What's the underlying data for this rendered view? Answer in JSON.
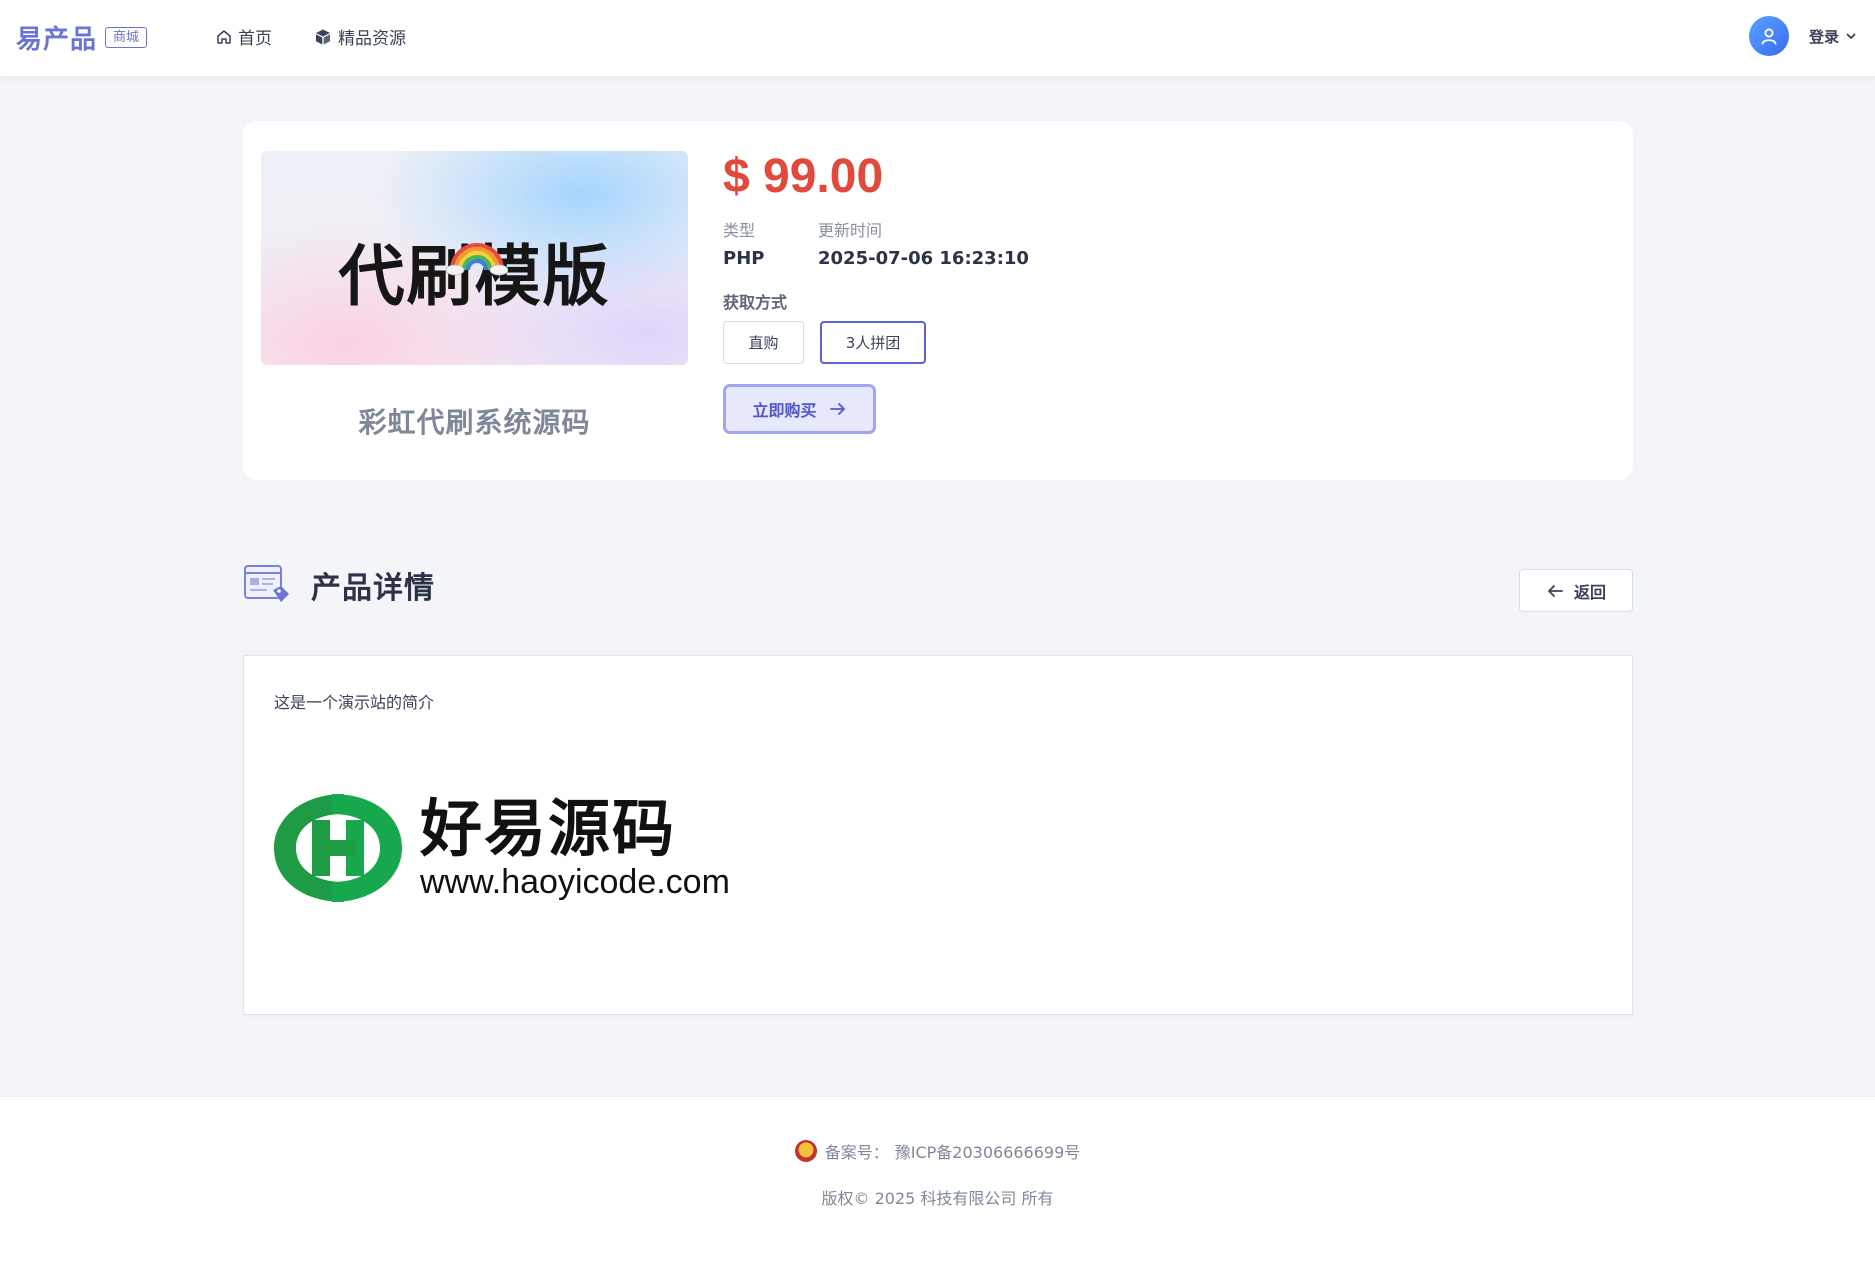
{
  "header": {
    "brand": "易产品",
    "badge": "商城",
    "nav": [
      {
        "label": "首页",
        "icon": "home-icon"
      },
      {
        "label": "精品资源",
        "icon": "box-icon"
      }
    ],
    "login_label": "登录"
  },
  "product": {
    "cover_text": "代刷模版",
    "title": "彩虹代刷系统源码",
    "price": "$ 99.00",
    "type_label": "类型",
    "type_value": "PHP",
    "updated_label": "更新时间",
    "updated_value": "2025-07-06 16:23:10",
    "method_label": "获取方式",
    "options": [
      "直购",
      "3人拼团"
    ],
    "selected_option": "3人拼团",
    "buy_label": "立即购买"
  },
  "details": {
    "title": "产品详情",
    "back_label": "返回",
    "intro": "这是一个演示站的简介",
    "logo_text": "好易源码",
    "logo_url": "www.haoyicode.com"
  },
  "footer": {
    "beian_label": "备案号：",
    "beian_value": "豫ICP备20306666699号",
    "copyright": "版权© 2025 科技有限公司 所有"
  },
  "colors": {
    "accent": "#6b74d6",
    "price": "#e2483c",
    "background": "#f4f5f9"
  }
}
